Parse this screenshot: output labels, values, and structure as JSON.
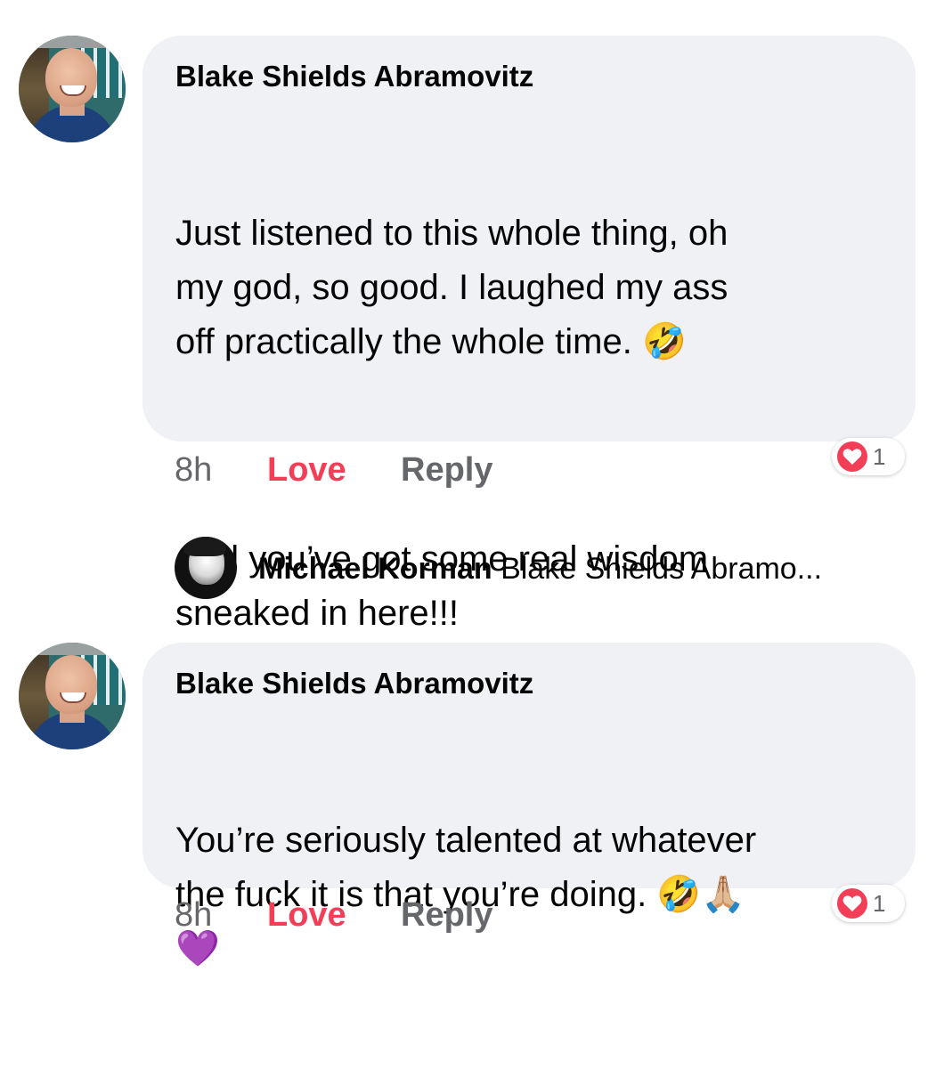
{
  "comments": [
    {
      "author": "Blake Shields Abramovitz",
      "paragraphs": [
        "Just listened to this whole thing, oh\nmy god, so good. I laughed my ass\noff practically the whole time. 🤣",
        "And you’ve got some real wisdom\nsneaked in here!!!"
      ],
      "time": "8h",
      "love_label": "Love",
      "reply_label": "Reply",
      "reaction_count": "1",
      "reaction_icon": "heart-icon"
    },
    {
      "author": "Blake Shields Abramovitz",
      "paragraphs": [
        "You’re seriously talented at whatever\nthe fuck it is that you’re doing. 🤣🙏🏼\n💜"
      ],
      "time": "8h",
      "love_label": "Love",
      "reply_label": "Reply",
      "reaction_count": "1",
      "reaction_icon": "heart-icon"
    }
  ],
  "reply_preview": {
    "author": "Michael Korman",
    "snippet": "Blake Shields Abramo..."
  },
  "colors": {
    "bubble_bg": "#eff1f5",
    "love": "#f33e58",
    "muted": "#65676b"
  }
}
